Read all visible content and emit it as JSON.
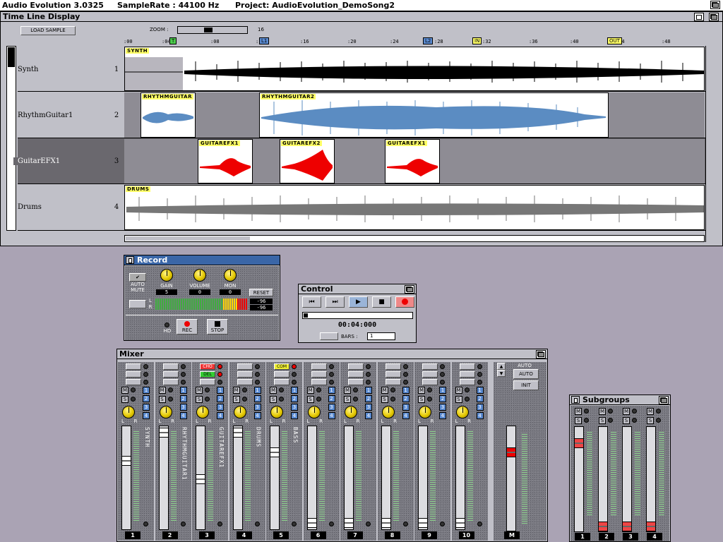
{
  "screen": {
    "app": "Audio Evolution 3.0325",
    "samplerate": "SampleRate : 44100 Hz",
    "project": "Project: AudioEvolution_DemoSong2"
  },
  "timeline": {
    "title": "Time Line Display",
    "load_button": "LOAD SAMPLE",
    "zoom_label": "ZOOM :",
    "zoom_value": "16",
    "ticks": [
      ":00",
      ":04",
      ":08",
      ":12",
      ":16",
      ":20",
      ":24",
      ":28",
      ":32",
      ":36",
      ":40",
      ":44",
      ":48"
    ],
    "markers": {
      "t": "T",
      "l1": "L1",
      "l2": "L2",
      "in": "IN",
      "out": "OUT"
    },
    "tracks": [
      {
        "name": "Synth",
        "num": "1",
        "regions": [
          "SYNTH"
        ]
      },
      {
        "name": "RhythmGuitar1",
        "num": "2",
        "regions": [
          "RHYTHMGUITAR",
          "RHYTHMGUITAR2"
        ]
      },
      {
        "name": "GuitarEFX1",
        "num": "3",
        "regions": [
          "GUITAREFX1",
          "GUITAREFX2",
          "GUITAREFX1"
        ]
      },
      {
        "name": "Drums",
        "num": "4",
        "regions": [
          "DRUMS"
        ]
      }
    ]
  },
  "record": {
    "title": "Record",
    "auto_mute": "AUTO MUTE",
    "gain_label": "GAIN",
    "gain_value": "5",
    "volume_label": "VOLUME",
    "volume_value": "0",
    "mon_label": "MON",
    "mon_value": "0",
    "reset": "RESET",
    "l": "L",
    "r": "R",
    "level_l": "-96",
    "level_r": "-96",
    "hd": "HD",
    "rec": "REC",
    "stop": "STOP"
  },
  "control": {
    "title": "Control",
    "time": "00:04:000",
    "bars_label": "BARS :",
    "bars_value": "1"
  },
  "mixer": {
    "title": "Mixer",
    "auto": "AUTO",
    "auto_btn": "AUTO",
    "init_btn": "INIT",
    "cho": "CHO",
    "del": "DEL",
    "com": "COM",
    "m": "M",
    "s": "S",
    "l": "L",
    "r": "R",
    "channels": [
      {
        "num": "1",
        "name": "SYNTH"
      },
      {
        "num": "2",
        "name": "RHYTHMGUITAR1"
      },
      {
        "num": "3",
        "name": "GUITAREFX1"
      },
      {
        "num": "4",
        "name": "DRUMS"
      },
      {
        "num": "5",
        "name": "BASS"
      },
      {
        "num": "6",
        "name": ""
      },
      {
        "num": "7",
        "name": ""
      },
      {
        "num": "8",
        "name": ""
      },
      {
        "num": "9",
        "name": ""
      },
      {
        "num": "10",
        "name": ""
      }
    ],
    "master": "M",
    "buses": [
      "1",
      "2",
      "3",
      "4"
    ]
  },
  "subgroups": {
    "title": "Subgroups",
    "nums": [
      "1",
      "2",
      "3",
      "4"
    ]
  }
}
